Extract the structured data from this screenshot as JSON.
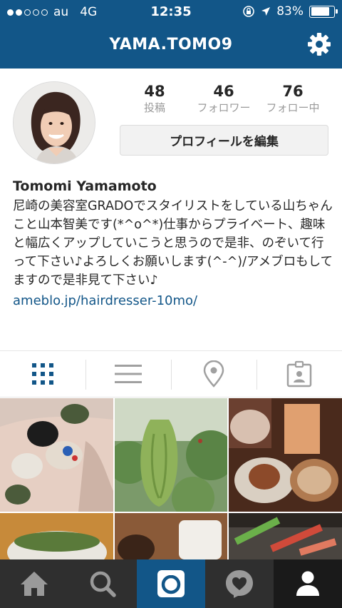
{
  "status_bar": {
    "carrier": "au",
    "network": "4G",
    "time": "12:35",
    "battery": "83%",
    "battery_level": 0.83
  },
  "header": {
    "username": "YAMA.TOMO9",
    "settings_icon": "gear-icon"
  },
  "stats": {
    "posts": {
      "count": "48",
      "label": "投稿"
    },
    "followers": {
      "count": "46",
      "label": "フォロワー"
    },
    "following": {
      "count": "76",
      "label": "フォロー中"
    }
  },
  "edit_profile_label": "プロフィールを編集",
  "bio": {
    "name": "Tomomi Yamamoto",
    "text": "尼崎の美容室GRADOでスタイリストをしている山ちゃんこと山本智美です(*^o^*)仕事からプライベート、趣味と幅広くアップしていこうと思うので是非、のぞいて行って下さい♪よろしくお願いします(^-^)/アメブロもしてますので是非見て下さい♪",
    "link": "ameblo.jp/hairdresser-10mo/"
  },
  "tabs": [
    {
      "icon": "grid-icon",
      "active": true
    },
    {
      "icon": "list-icon",
      "active": false
    },
    {
      "icon": "location-pin-icon",
      "active": false
    },
    {
      "icon": "tagged-photos-icon",
      "active": false
    }
  ],
  "colors": {
    "brand": "#125688",
    "tab_bar": "#2f2f2f"
  },
  "bottom_nav": [
    {
      "icon": "home-icon"
    },
    {
      "icon": "search-icon"
    },
    {
      "icon": "camera-icon"
    },
    {
      "icon": "activity-heart-icon"
    },
    {
      "icon": "profile-icon"
    }
  ]
}
